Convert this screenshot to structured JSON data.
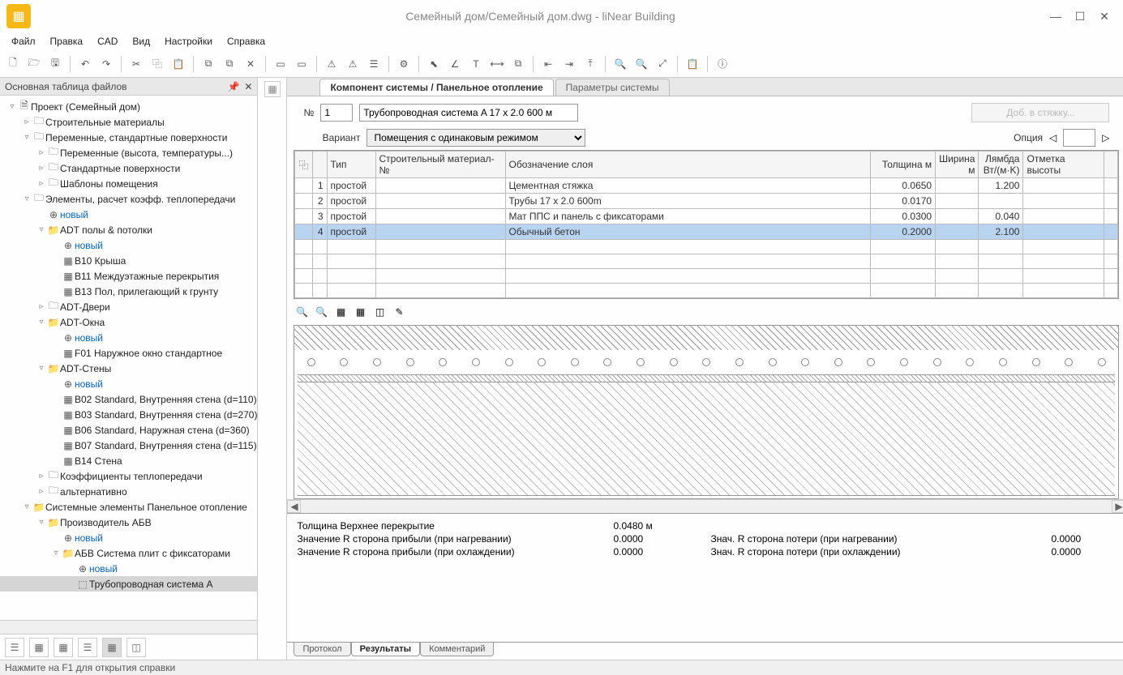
{
  "title": "Семейный дом/Семейный дом.dwg - liNear Building",
  "menubar": [
    "Файл",
    "Правка",
    "CAD",
    "Вид",
    "Настройки",
    "Справка"
  ],
  "sidebar": {
    "title": "Основная таблица файлов",
    "items": [
      {
        "pad": 0,
        "exp": "▿",
        "ico": "🗎",
        "label": "Проект (Семейный дом)"
      },
      {
        "pad": 1,
        "exp": "▹",
        "ico": "🗀",
        "label": "Строительные материалы"
      },
      {
        "pad": 1,
        "exp": "▿",
        "ico": "🗀",
        "label": "Переменные, стандартные поверхности"
      },
      {
        "pad": 2,
        "exp": "▹",
        "ico": "🗀",
        "label": "Переменные (высота, температуры...)"
      },
      {
        "pad": 2,
        "exp": "▹",
        "ico": "🗀",
        "label": "Стандартные поверхности"
      },
      {
        "pad": 2,
        "exp": "▹",
        "ico": "🗀",
        "label": "Шаблоны помещения"
      },
      {
        "pad": 1,
        "exp": "▿",
        "ico": "🗀",
        "label": "Элементы, расчет коэфф. теплопередачи"
      },
      {
        "pad": 2,
        "exp": "",
        "ico": "⊕",
        "label": "новый",
        "link": true
      },
      {
        "pad": 2,
        "exp": "▿",
        "ico": "📁",
        "label": "ADT полы & потолки"
      },
      {
        "pad": 3,
        "exp": "",
        "ico": "⊕",
        "label": "новый",
        "link": true
      },
      {
        "pad": 3,
        "exp": "",
        "ico": "▦",
        "label": "B10 Крыша"
      },
      {
        "pad": 3,
        "exp": "",
        "ico": "▦",
        "label": "B11 Междуэтажные перекрытия"
      },
      {
        "pad": 3,
        "exp": "",
        "ico": "▦",
        "label": "B13 Пол, прилегающий к грунту"
      },
      {
        "pad": 2,
        "exp": "▹",
        "ico": "🗀",
        "label": "ADT-Двери"
      },
      {
        "pad": 2,
        "exp": "▿",
        "ico": "📁",
        "label": "ADT-Окна"
      },
      {
        "pad": 3,
        "exp": "",
        "ico": "⊕",
        "label": "новый",
        "link": true
      },
      {
        "pad": 3,
        "exp": "",
        "ico": "▦",
        "label": "F01 Наружное окно стандартное"
      },
      {
        "pad": 2,
        "exp": "▿",
        "ico": "📁",
        "label": "ADT-Стены"
      },
      {
        "pad": 3,
        "exp": "",
        "ico": "⊕",
        "label": "новый",
        "link": true
      },
      {
        "pad": 3,
        "exp": "",
        "ico": "▦",
        "label": "B02 Standard, Внутренняя стена (d=110)"
      },
      {
        "pad": 3,
        "exp": "",
        "ico": "▦",
        "label": "B03 Standard, Внутренняя стена (d=270)"
      },
      {
        "pad": 3,
        "exp": "",
        "ico": "▦",
        "label": "B06 Standard, Наружная стена (d=360)"
      },
      {
        "pad": 3,
        "exp": "",
        "ico": "▦",
        "label": "B07 Standard, Внутренняя стена (d=115)"
      },
      {
        "pad": 3,
        "exp": "",
        "ico": "▦",
        "label": "B14 Стена"
      },
      {
        "pad": 2,
        "exp": "▹",
        "ico": "🗀",
        "label": "Коэффициенты теплопередачи"
      },
      {
        "pad": 2,
        "exp": "▹",
        "ico": "🗀",
        "label": "альтернативно"
      },
      {
        "pad": 1,
        "exp": "▿",
        "ico": "📁",
        "label": "Системные элементы Панельное отопление"
      },
      {
        "pad": 2,
        "exp": "▿",
        "ico": "📁",
        "label": "Производитель АБВ"
      },
      {
        "pad": 3,
        "exp": "",
        "ico": "⊕",
        "label": "новый",
        "link": true
      },
      {
        "pad": 3,
        "exp": "▿",
        "ico": "📁",
        "label": "АБВ Система плит с фиксаторами"
      },
      {
        "pad": 4,
        "exp": "",
        "ico": "⊕",
        "label": "новый",
        "link": true
      },
      {
        "pad": 4,
        "exp": "",
        "ico": "⬚",
        "label": "Трубопроводная система A",
        "selected": true
      }
    ]
  },
  "tabs": {
    "active": "Компонент системы / Панельное отопление",
    "other": "Параметры системы"
  },
  "form": {
    "no_label": "№",
    "no": "1",
    "name": "Трубопроводная система A 17 x 2.0 600 м",
    "dobbtn": "Доб. в стяжку...",
    "variant_label": "Вариант",
    "variant": "Помещения с одинаковым режимом",
    "option_label": "Опция",
    "option": ""
  },
  "grid": {
    "headers": {
      "type": "Тип",
      "mat": "Строительный материал-№",
      "layer": "Обозначение слоя",
      "thick": "Толщина\nм",
      "width": "Ширина\nм",
      "lambda": "Лямбда\nВт/(м·K)",
      "mark": "Отметка высоты"
    },
    "rows": [
      {
        "n": "1",
        "type": "простой",
        "mat": "",
        "layer": "Цементная стяжка",
        "thick": "0.0650",
        "width": "",
        "lambda": "1.200",
        "mark": ""
      },
      {
        "n": "2",
        "type": "простой",
        "mat": "",
        "layer": "Трубы 17 x 2.0 600m",
        "thick": "0.0170",
        "width": "",
        "lambda": "",
        "mark": ""
      },
      {
        "n": "3",
        "type": "простой",
        "mat": "",
        "layer": "Мат ППС и панель с фиксаторами",
        "thick": "0.0300",
        "width": "",
        "lambda": "0.040",
        "mark": ""
      },
      {
        "n": "4",
        "type": "простой",
        "mat": "",
        "layer": "Обычный бетон",
        "thick": "0.2000",
        "width": "",
        "lambda": "2.100",
        "mark": "",
        "sel": true
      }
    ]
  },
  "results": {
    "left": [
      {
        "label": "Толщина Верхнее перекрытие",
        "value": "0.0480 м"
      },
      {
        "label": "Значение R сторона прибыли (при нагревании)",
        "value": "0.0000"
      },
      {
        "label": "Значение R сторона прибыли (при охлаждении)",
        "value": "0.0000"
      }
    ],
    "right": [
      {
        "label": "Знач. R сторона потери (при нагревании)",
        "value": "0.0000"
      },
      {
        "label": "Знач. R сторона потери (при охлаждении)",
        "value": "0.0000"
      }
    ]
  },
  "bottom_tabs": [
    "Протокол",
    "Результаты",
    "Комментарий"
  ],
  "statusbar": "Нажмите на F1 для открытия справки"
}
